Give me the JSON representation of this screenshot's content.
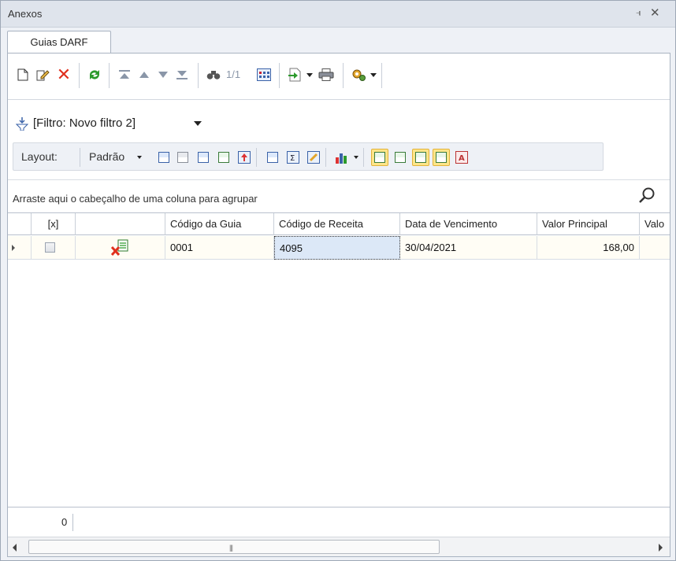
{
  "window": {
    "title": "Anexos",
    "pin_glyph": "ᵖ",
    "close_glyph": "×"
  },
  "tabs": [
    {
      "label": "Guias DARF"
    }
  ],
  "toolbar": {
    "position_text": "1/1",
    "icons": [
      "new-document-icon",
      "edit-icon",
      "delete-icon",
      "refresh-icon",
      "first-record-icon",
      "previous-record-icon",
      "next-record-icon",
      "last-record-icon",
      "find-icon",
      "calendar-grid-icon",
      "export-icon",
      "print-icon",
      "settings-icon"
    ]
  },
  "filter": {
    "label": "[Filtro: Novo filtro 2]"
  },
  "layoutbar": {
    "layout_label": "Layout:",
    "preset_label": "Padrão"
  },
  "groupbar": {
    "hint": "Arraste aqui o cabeçalho de uma coluna para agrupar"
  },
  "grid": {
    "columns": [
      "[x]",
      "",
      "Código da Guia",
      "Código de Receita",
      "Data de Vencimento",
      "Valor Principal",
      "Valo"
    ],
    "rows": [
      {
        "codigo_guia": "0001",
        "codigo_receita": "4095",
        "data_vencimento": "30/04/2021",
        "valor_principal": "168,00"
      }
    ]
  },
  "footer": {
    "count": "0"
  },
  "colors": {
    "accent_active": "#fde58a",
    "delete_red": "#e0301e",
    "refresh_green": "#2c9a2c"
  }
}
